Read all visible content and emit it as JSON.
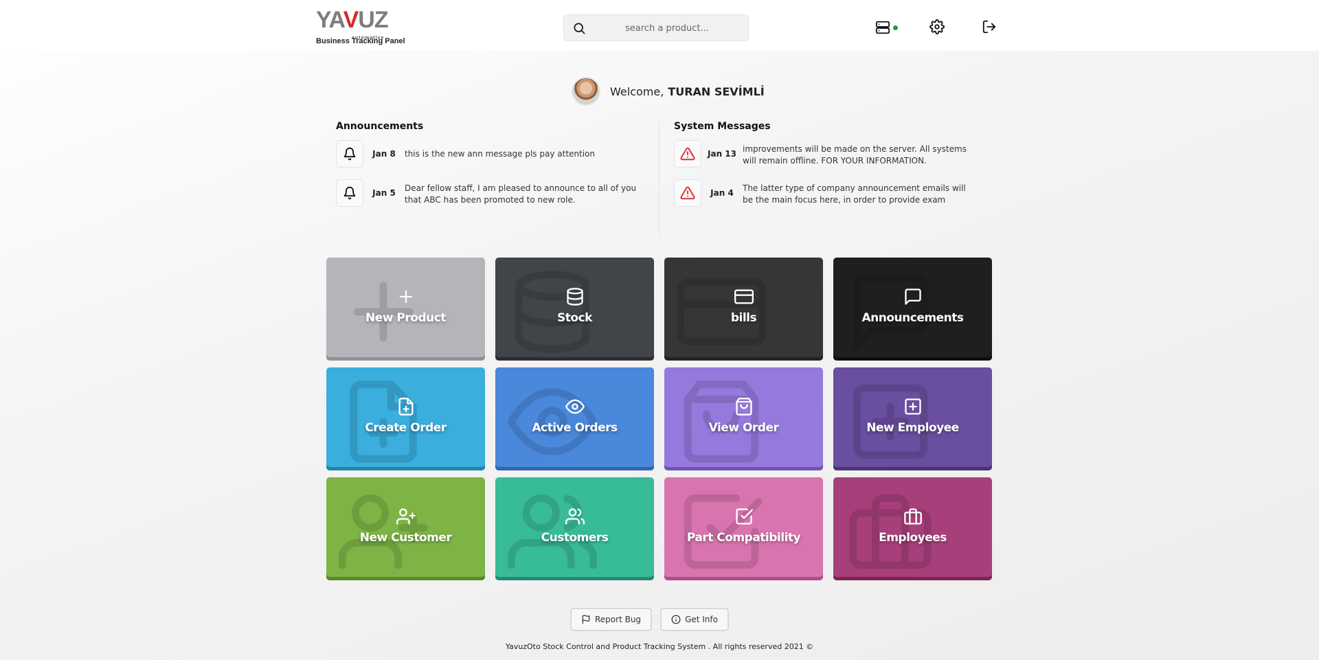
{
  "header": {
    "logo_text_left": "YA",
    "logo_text_accent": "V",
    "logo_text_right": "UZ",
    "logo_subtext": "automotive",
    "caption": "Business Tracking Panel",
    "search_placeholder": "search a product...",
    "icons": [
      "server-icon",
      "settings-icon",
      "logout-icon"
    ],
    "status_color": "#1aa33a"
  },
  "welcome": {
    "prefix": "Welcome,",
    "name": "TURAN SEVİMLİ"
  },
  "announcements": {
    "title": "Announcements",
    "items": [
      {
        "date": "Jan 8",
        "text": "this is the new ann message pls pay attention",
        "icon": "bell-icon"
      },
      {
        "date": "Jan 5",
        "text": "Dear fellow staff, I am pleased to announce to all of you that ABC has been promoted to new role.",
        "icon": "bell-icon"
      }
    ]
  },
  "system_messages": {
    "title": "System Messages",
    "items": [
      {
        "date": "Jan 13",
        "text": "improvements will be made on the server. All systems will remain offline. FOR YOUR INFORMATION.",
        "icon": "warning-icon"
      },
      {
        "date": "Jan 4",
        "text": "The latter type of company announcement emails will be the main focus here, in order to provide exam",
        "icon": "warning-icon"
      }
    ],
    "accent_color": "#e03131"
  },
  "tiles": [
    {
      "label": "New Product",
      "icon": "plus-icon",
      "color": "#b3b5b9",
      "shadow": "#8f9196"
    },
    {
      "label": "Stock",
      "icon": "database-icon",
      "color": "#414449",
      "shadow": "#2c2e31"
    },
    {
      "label": "bills",
      "icon": "credit-card-icon",
      "color": "#353638",
      "shadow": "#232325"
    },
    {
      "label": "Announcements",
      "icon": "message-icon",
      "color": "#1e1f21",
      "shadow": "#0f0f10"
    },
    {
      "label": "Create Order",
      "icon": "file-plus-icon",
      "color": "#3aaedc",
      "shadow": "#2684aa"
    },
    {
      "label": "Active Orders",
      "icon": "eye-icon",
      "color": "#4a88dc",
      "shadow": "#2f66b0"
    },
    {
      "label": "View Order",
      "icon": "shopping-bag-icon",
      "color": "#9579dc",
      "shadow": "#6e55b4"
    },
    {
      "label": "New Employee",
      "icon": "plus-square-icon",
      "color": "#6a4e9f",
      "shadow": "#4a3475"
    },
    {
      "label": "New Customer",
      "icon": "user-plus-icon",
      "color": "#7db445",
      "shadow": "#5a8a2a"
    },
    {
      "label": "Customers",
      "icon": "users-icon",
      "color": "#38bb98",
      "shadow": "#238b70"
    },
    {
      "label": "Part Compatibility",
      "icon": "check-square-icon",
      "color": "#d874ae",
      "shadow": "#ad4f86"
    },
    {
      "label": "Employees",
      "icon": "briefcase-icon",
      "color": "#a73f7b",
      "shadow": "#7a2656"
    }
  ],
  "actions": {
    "report_bug": "Report Bug",
    "get_info": "Get Info"
  },
  "footer": {
    "text": "YavuzOto Stock Control and Product Tracking System . All rights reserved 2021 ©"
  }
}
